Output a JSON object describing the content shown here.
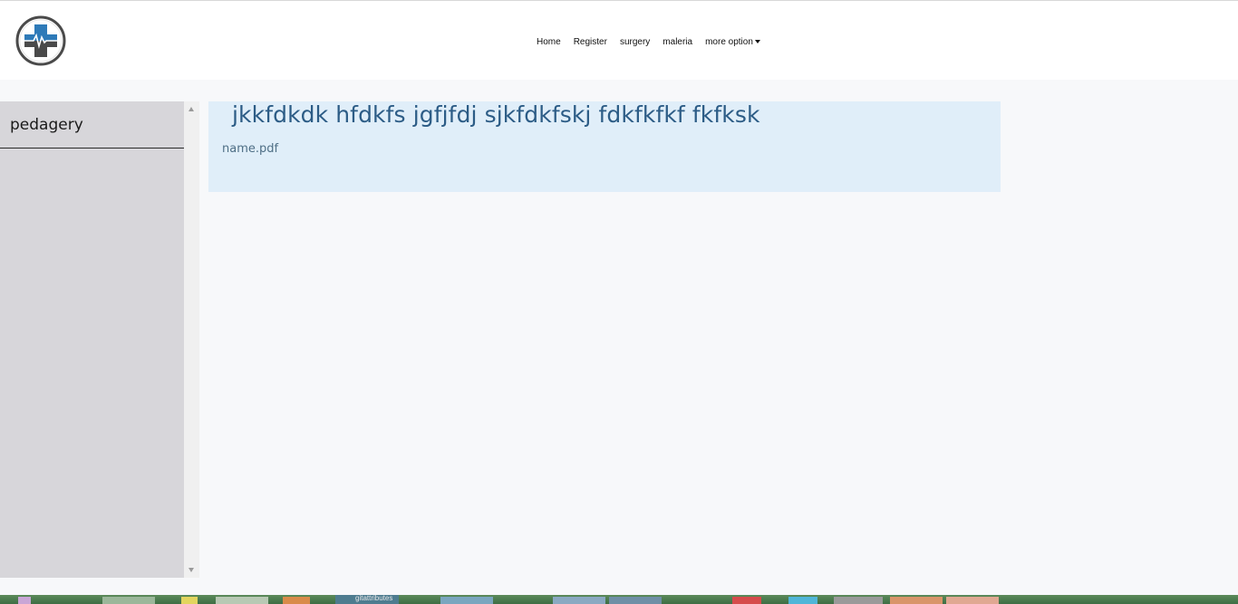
{
  "header": {
    "logo": "medical-cross-heartbeat-logo",
    "nav": {
      "home": "Home",
      "register": "Register",
      "surgery": "surgery",
      "maleria": "maleria",
      "more_option": "more option"
    }
  },
  "sidebar": {
    "items": [
      {
        "label": "pedagery"
      }
    ]
  },
  "main": {
    "card": {
      "title": "jkkfdkdk hfdkfs jgfjfdj sjkfdkfskj fdkfkfkf fkfksk",
      "file": "name.pdf"
    }
  },
  "taskbar": {
    "partial_label": "gitattributes"
  },
  "colors": {
    "card_bg": "#e0eef9",
    "card_title": "#2c5c86",
    "sidebar_bg": "#d7d6da",
    "page_bg": "#f7f8fa",
    "logo_blue": "#2e7ab8",
    "logo_gray": "#4a4a4a"
  }
}
